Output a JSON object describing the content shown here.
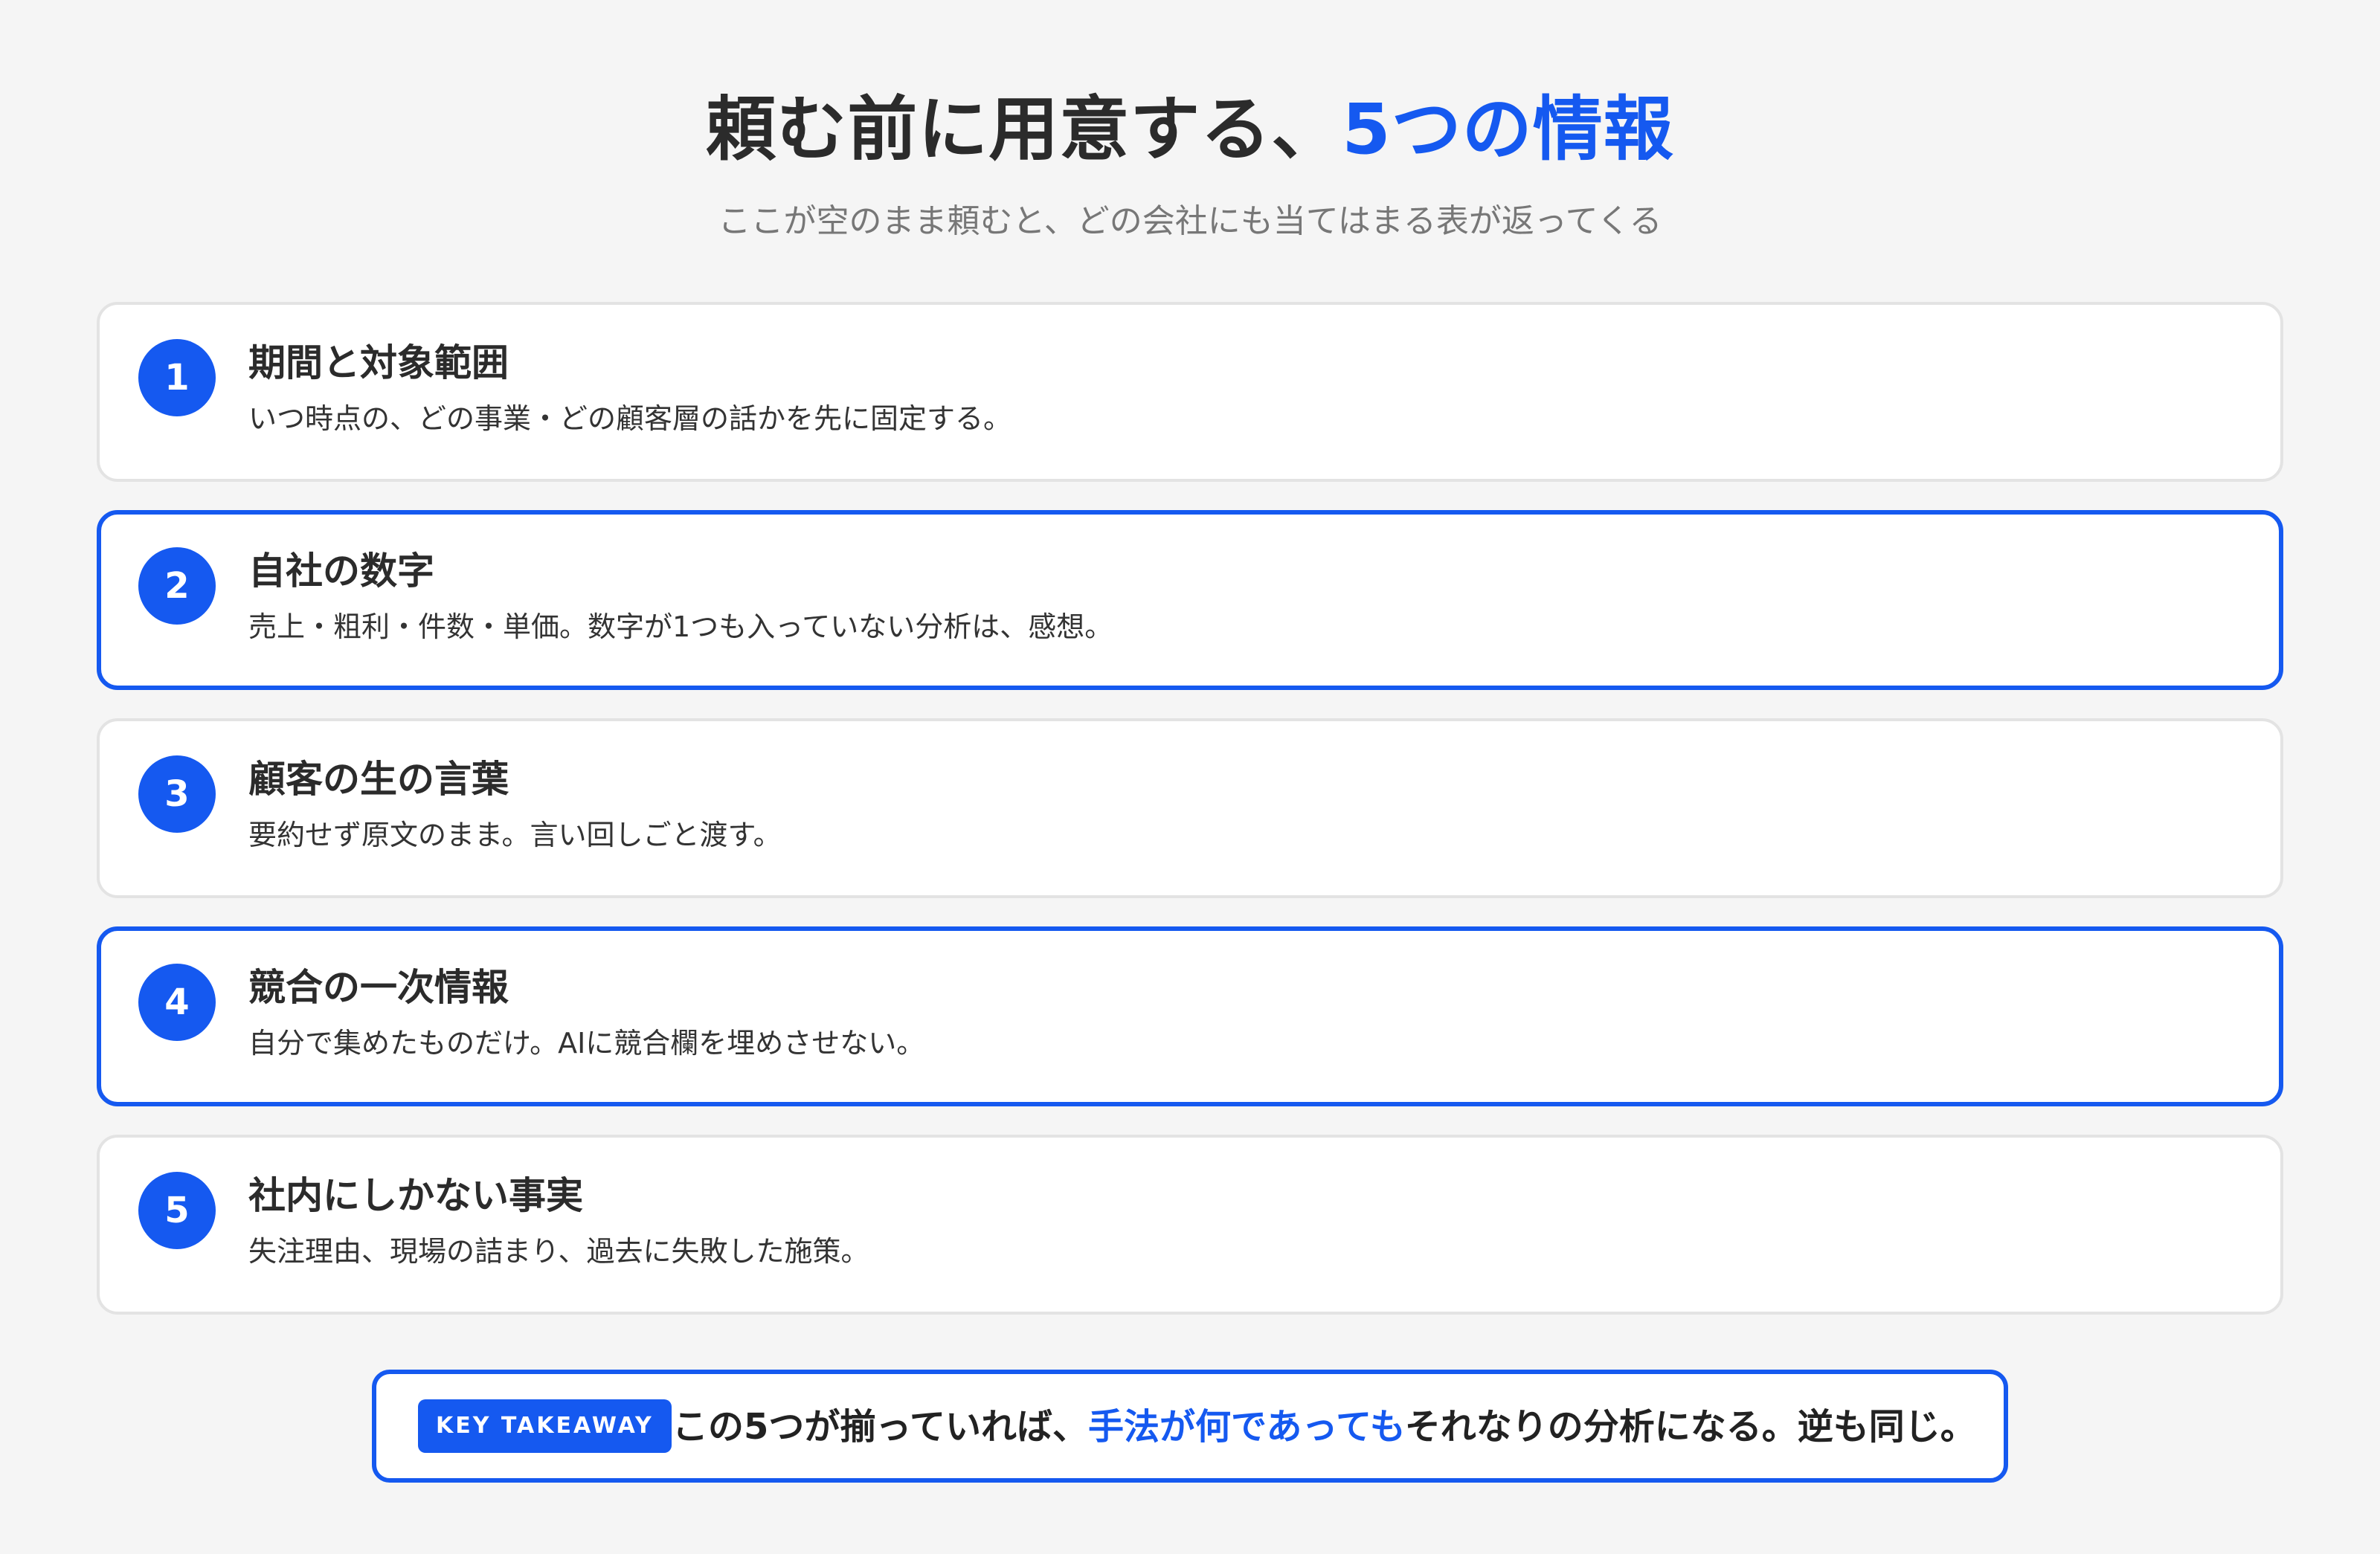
{
  "header": {
    "title_main": "頼む前に用意する、",
    "title_accent": "5つの情報",
    "subtitle": "ここが空のまま頼むと、どの会社にも当てはまる表が返ってくる"
  },
  "items": [
    {
      "number": "1",
      "title": "期間と対象範囲",
      "description": "いつ時点の、どの事業・どの顧客層の話かを先に固定する。",
      "highlighted": false
    },
    {
      "number": "2",
      "title": "自社の数字",
      "description": "売上・粗利・件数・単価。数字が1つも入っていない分析は、感想。",
      "highlighted": true
    },
    {
      "number": "3",
      "title": "顧客の生の言葉",
      "description": "要約せず原文のまま。言い回しごと渡す。",
      "highlighted": false
    },
    {
      "number": "4",
      "title": "競合の一次情報",
      "description": "自分で集めたものだけ。AIに競合欄を埋めさせない。",
      "highlighted": true
    },
    {
      "number": "5",
      "title": "社内にしかない事実",
      "description": "失注理由、現場の詰まり、過去に失敗した施策。",
      "highlighted": false
    }
  ],
  "takeaway": {
    "badge": "KEY TAKEAWAY",
    "text_before": "この5つが揃っていれば、",
    "text_accent": "手法が何であっても",
    "text_after": "それなりの分析になる。逆も同じ。"
  },
  "colors": {
    "accent": "#1559f0",
    "background": "#f5f5f5",
    "card_border": "#e3e3e3",
    "text": "#2b2b2b",
    "subtitle": "#777777"
  }
}
